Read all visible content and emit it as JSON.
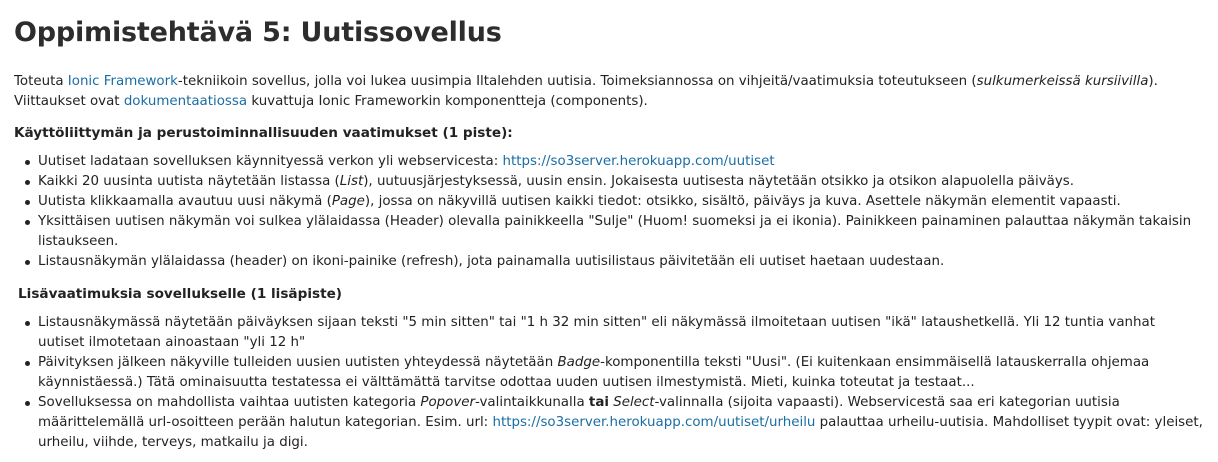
{
  "title": "Oppimistehtävä 5: Uutissovellus",
  "intro": {
    "t1": "Toteuta ",
    "link1": "Ionic Framework",
    "t2": "-tekniikoin sovellus, jolla voi lukea uusimpia Iltalehden uutisia. Toimeksiannossa on vihjeitä/vaatimuksia toteutukseen (",
    "em1": "sulkumerkeissä kursiivilla",
    "t3": "). Viittaukset ovat ",
    "link2": "dokumentaatiossa",
    "t4": " kuvattuja Ionic Frameworkin komponentteja (components)."
  },
  "section1": {
    "heading": "Käyttöliittymän ja perustoiminnallisuuden vaatimukset (1 piste):",
    "items": [
      {
        "a": "Uutiset ladataan sovelluksen käynnityessä verkon yli webservicesta: ",
        "link": "https://so3server.herokuapp.com/uutiset"
      },
      {
        "a": "Kaikki 20 uusinta uutista näytetään listassa (",
        "em": "List",
        "b": "), uutuusjärjestyksessä, uusin ensin. Jokaisesta uutisesta näytetään otsikko ja otsikon alapuolella päiväys."
      },
      {
        "a": "Uutista klikkaamalla avautuu uusi näkymä (",
        "em": "Page",
        "b": "), jossa on näkyvillä uutisen kaikki tiedot: otsikko, sisältö, päiväys ja kuva. Asettele näkymän elementit vapaasti."
      },
      {
        "a": "Yksittäisen uutisen näkymän voi sulkea ylälaidassa (Header) olevalla painikkeella \"Sulje\" (Huom! suomeksi ja ei ikonia). Painikkeen painaminen palauttaa näkymän takaisin listaukseen."
      },
      {
        "a": "Listausnäkymän ylälaidassa (header) on ikoni-painike (refresh), jota painamalla uutisilistaus päivitetään eli uutiset haetaan uudestaan."
      }
    ]
  },
  "section2": {
    "heading": "Lisävaatimuksia sovellukselle (1 lisäpiste)",
    "items": [
      {
        "a": "Listausnäkymässä näytetään päiväyksen sijaan teksti \"5 min sitten\" tai \"1 h 32 min sitten\" eli näkymässä ilmoitetaan uutisen \"ikä\" latausheтkellä. Yli 12 tuntia vanhat uutiset ilmotetaan ainoastaan \"yli 12 h\""
      },
      {
        "a": "Päivityksen jälkeen näkyville tulleiden uusien uutisten yhteydessä näytetään ",
        "em": "Badge",
        "b": "-komponentilla teksti \"Uusi\". (Ei kuitenkaan ensimmäisellä latauskerralla ohjemaa käynnistäessä.) Tätä ominaisuutta testatessa ei välttämättä tarvitse odottaa uuden uutisen ilmestymistä. Mieti, kuinka toteutat ja testaat..."
      },
      {
        "a": "Sovelluksessa on mahdollista vaihtaa uutisten kategoria ",
        "em": "Popover",
        "b": "-valintaikkunalla ",
        "strong": "tai",
        "c": " ",
        "em2": "Select",
        "d": "-valinnalla (sijoita vapaasti). Webservicestä saa eri kategorian uutisia määrittelemällä url-osoitteen perään halutun kategorian. Esim. url: ",
        "link": "https://so3server.herokuapp.com/uutiset/urheilu",
        "e": " palauttaa urheilu-uutisia. Mahdolliset tyypit ovat: yleiset, urheilu, viihde, terveys, matkailu ja digi."
      }
    ]
  },
  "colors": {
    "link": "#1a6da3",
    "text": "#222222",
    "heading": "#2d2d2d"
  }
}
